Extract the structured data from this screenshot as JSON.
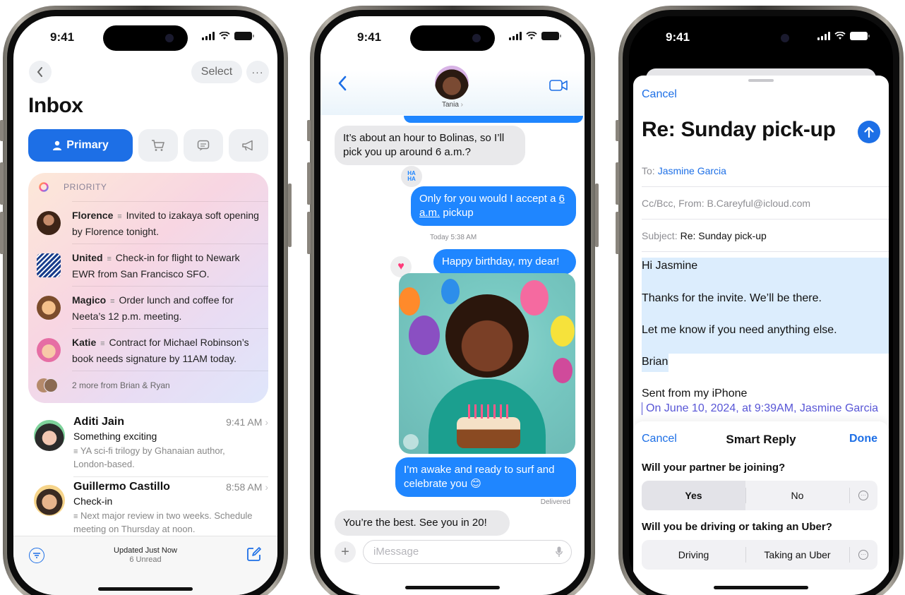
{
  "status": {
    "time": "9:41"
  },
  "mail": {
    "select_label": "Select",
    "more_icon": "ellipsis-icon",
    "back_icon": "chevron-left-icon",
    "title": "Inbox",
    "categories": [
      {
        "label": "Primary",
        "icon": "person-icon"
      },
      {
        "label": "",
        "icon": "cart-icon"
      },
      {
        "label": "",
        "icon": "message-icon"
      },
      {
        "label": "",
        "icon": "megaphone-icon"
      }
    ],
    "priority": {
      "label": "PRIORITY",
      "items": [
        {
          "sender": "Florence",
          "summary": "Invited to izakaya soft opening by Florence tonight."
        },
        {
          "sender": "United",
          "summary": "Check-in for flight to Newark EWR from San Francisco SFO."
        },
        {
          "sender": "Magico",
          "summary": "Order lunch and coffee for Neeta’s 12 p.m. meeting."
        },
        {
          "sender": "Katie",
          "summary": "Contract for Michael Robinson’s book needs signature by 11AM today."
        }
      ],
      "more": "2 more from Brian & Ryan"
    },
    "messages": [
      {
        "sender": "Aditi Jain",
        "time": "9:41 AM",
        "subject": "Something exciting",
        "preview": "YA sci-fi trilogy by Ghanaian author, London-based."
      },
      {
        "sender": "Guillermo Castillo",
        "time": "8:58 AM",
        "subject": "Check-in",
        "preview": "Next major review in two weeks. Schedule meeting on Thursday at noon."
      }
    ],
    "bottom": {
      "updated": "Updated Just Now",
      "unread": "6 Unread"
    }
  },
  "messages": {
    "contact_name": "Tania",
    "bubbles": [
      {
        "dir": "in",
        "text": "It’s about an hour to Bolinas, so I’ll pick you up around 6 a.m.?"
      },
      {
        "dir": "out",
        "text_1": "Only for you would I accept a",
        "text_2": "6 a.m.",
        "text_3": " pickup"
      },
      {
        "dir": "out",
        "text": "Happy birthday, my dear!"
      },
      {
        "dir": "out",
        "text": "I’m awake and ready to surf and celebrate you 😊"
      },
      {
        "dir": "in",
        "text": "You’re the best. See you in 20!"
      }
    ],
    "timestamp": "Today 5:38 AM",
    "delivered": "Delivered",
    "tapback_haha": "HA HA",
    "input_placeholder": "iMessage"
  },
  "compose": {
    "cancel": "Cancel",
    "subject_title": "Re: Sunday pick-up",
    "to_label": "To:",
    "to_value": "Jasmine Garcia",
    "ccbcc": "Cc/Bcc, From: B.Careyful@icloud.com",
    "subject_label": "Subject:",
    "subject_value": "Re: Sunday pick-up",
    "body": [
      "Hi Jasmine",
      "Thanks for the invite. We’ll be there.",
      "Let me know if you need anything else.",
      "Brian"
    ],
    "signature": "Sent from my iPhone",
    "quoted": "On June 10, 2024, at 9:39AM, Jasmine Garcia"
  },
  "smart_reply": {
    "cancel": "Cancel",
    "title": "Smart Reply",
    "done": "Done",
    "questions": [
      {
        "q": "Will your partner be joining?",
        "options": [
          "Yes",
          "No"
        ],
        "selected": "Yes"
      },
      {
        "q": "Will you be driving or taking an Uber?",
        "options": [
          "Driving",
          "Taking an Uber"
        ],
        "selected": null
      }
    ]
  },
  "colors": {
    "accent": "#1d6fe6",
    "bubble_out": "#1f86ff",
    "bubble_in": "#e9e9eb"
  }
}
